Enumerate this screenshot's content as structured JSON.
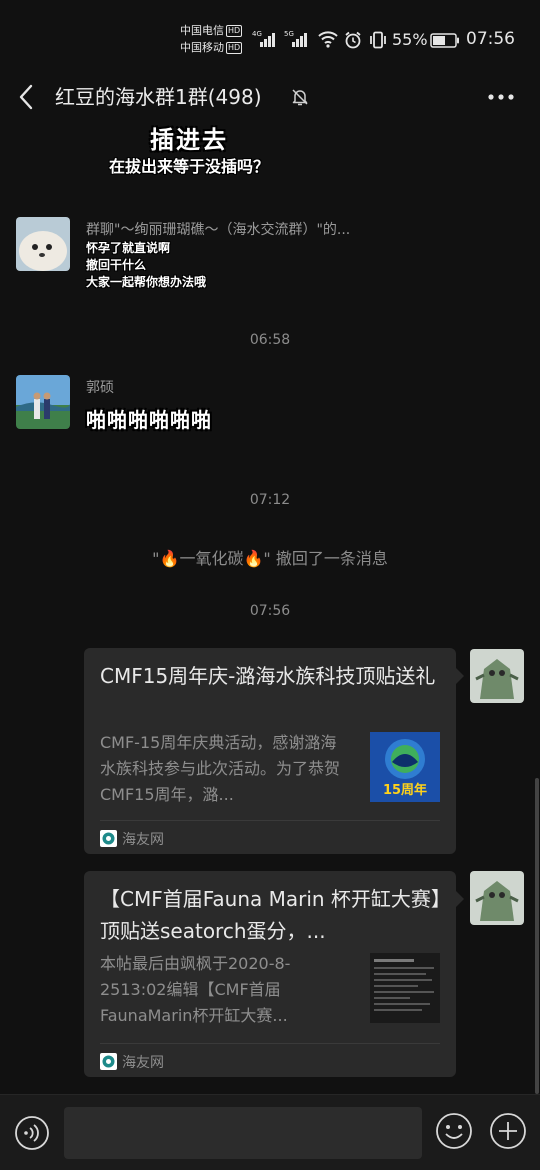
{
  "status_bar": {
    "carrier_1": "中国电信",
    "carrier_2": "中国移动",
    "hd_badge": "HD",
    "net_1": "4G",
    "net_2": "5G",
    "battery": "55%",
    "time": "07:56"
  },
  "header": {
    "title": "红豆的海水群1群(498)",
    "back_icon": "chevron-left-icon",
    "mute_icon": "bell-muted-icon",
    "more_icon": "more-dots-icon"
  },
  "messages": {
    "top_meme": {
      "line1": "插进去",
      "line2": "在拔出来等于没插吗？"
    },
    "forward": {
      "sender": "群聊\"～绚丽珊瑚礁～（海水交流群）\"的...",
      "lines": [
        "怀孕了就直说啊",
        "撤回干什么",
        "大家一起帮你想办法哦"
      ]
    },
    "time_1": "06:58",
    "guo": {
      "sender": "郭硕",
      "meme": "啪啪啪啪啪啪"
    },
    "time_2": "07:12",
    "recall": {
      "prefix": "\"",
      "fire": "🔥",
      "name": "一氧化碳",
      "suffix": "\" 撤回了一条消息"
    },
    "time_3": "07:56",
    "card_1": {
      "title": "CMF15周年庆-潞海水族科技顶贴送礼",
      "description": "CMF-15周年庆典活动，感谢潞海水族科技参与此次活动。为了恭贺CMF15周年，潞...",
      "thumb_text": "15周年",
      "source": "海友网"
    },
    "card_2": {
      "title": "【CMF首届Fauna Marin 杯开缸大赛】顶贴送seatorch蛋分，...",
      "description": "本帖最后由飒枫于2020-8-2513:02编辑【CMF首届FaunaMarin杯开缸大赛...",
      "source": "海友网"
    }
  },
  "input_bar": {
    "placeholder": "",
    "voice_icon": "voice-icon",
    "emoji_icon": "emoji-icon",
    "plus_icon": "plus-icon"
  },
  "colors": {
    "background": "#111111",
    "card": "#2a2a2a",
    "input_bar": "#1b1b1b",
    "timestamp": "#8c8c8c"
  }
}
